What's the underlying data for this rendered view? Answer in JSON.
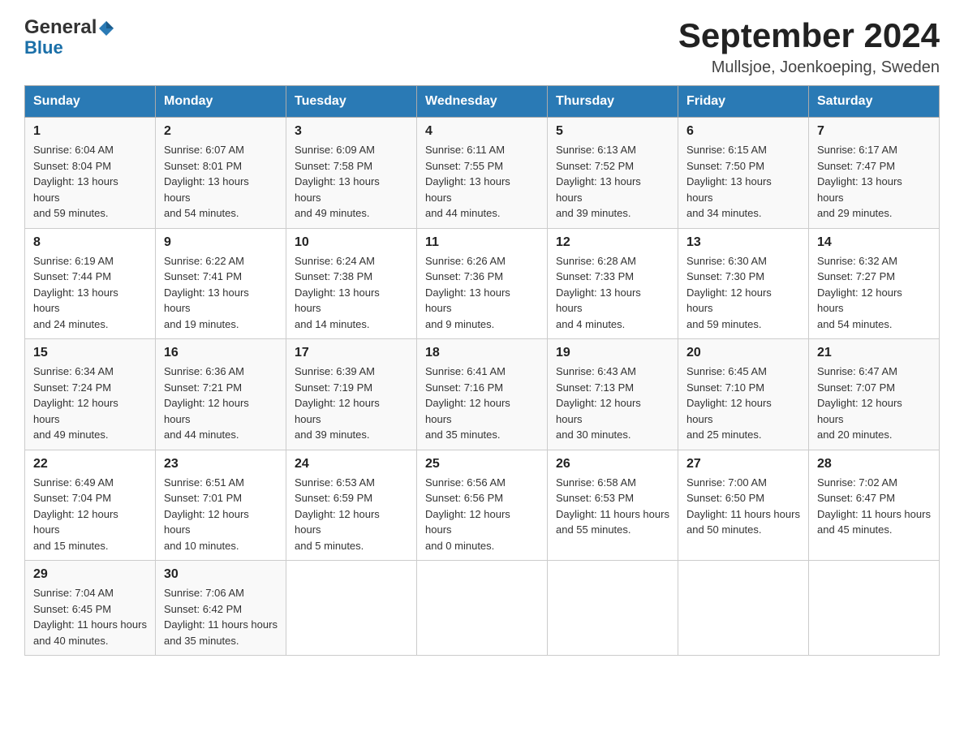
{
  "header": {
    "title": "September 2024",
    "subtitle": "Mullsjoe, Joenkoeping, Sweden",
    "logo": {
      "general": "General",
      "blue": "Blue"
    }
  },
  "weekdays": [
    "Sunday",
    "Monday",
    "Tuesday",
    "Wednesday",
    "Thursday",
    "Friday",
    "Saturday"
  ],
  "weeks": [
    [
      {
        "day": "1",
        "sunrise": "6:04 AM",
        "sunset": "8:04 PM",
        "daylight": "13 hours and 59 minutes."
      },
      {
        "day": "2",
        "sunrise": "6:07 AM",
        "sunset": "8:01 PM",
        "daylight": "13 hours and 54 minutes."
      },
      {
        "day": "3",
        "sunrise": "6:09 AM",
        "sunset": "7:58 PM",
        "daylight": "13 hours and 49 minutes."
      },
      {
        "day": "4",
        "sunrise": "6:11 AM",
        "sunset": "7:55 PM",
        "daylight": "13 hours and 44 minutes."
      },
      {
        "day": "5",
        "sunrise": "6:13 AM",
        "sunset": "7:52 PM",
        "daylight": "13 hours and 39 minutes."
      },
      {
        "day": "6",
        "sunrise": "6:15 AM",
        "sunset": "7:50 PM",
        "daylight": "13 hours and 34 minutes."
      },
      {
        "day": "7",
        "sunrise": "6:17 AM",
        "sunset": "7:47 PM",
        "daylight": "13 hours and 29 minutes."
      }
    ],
    [
      {
        "day": "8",
        "sunrise": "6:19 AM",
        "sunset": "7:44 PM",
        "daylight": "13 hours and 24 minutes."
      },
      {
        "day": "9",
        "sunrise": "6:22 AM",
        "sunset": "7:41 PM",
        "daylight": "13 hours and 19 minutes."
      },
      {
        "day": "10",
        "sunrise": "6:24 AM",
        "sunset": "7:38 PM",
        "daylight": "13 hours and 14 minutes."
      },
      {
        "day": "11",
        "sunrise": "6:26 AM",
        "sunset": "7:36 PM",
        "daylight": "13 hours and 9 minutes."
      },
      {
        "day": "12",
        "sunrise": "6:28 AM",
        "sunset": "7:33 PM",
        "daylight": "13 hours and 4 minutes."
      },
      {
        "day": "13",
        "sunrise": "6:30 AM",
        "sunset": "7:30 PM",
        "daylight": "12 hours and 59 minutes."
      },
      {
        "day": "14",
        "sunrise": "6:32 AM",
        "sunset": "7:27 PM",
        "daylight": "12 hours and 54 minutes."
      }
    ],
    [
      {
        "day": "15",
        "sunrise": "6:34 AM",
        "sunset": "7:24 PM",
        "daylight": "12 hours and 49 minutes."
      },
      {
        "day": "16",
        "sunrise": "6:36 AM",
        "sunset": "7:21 PM",
        "daylight": "12 hours and 44 minutes."
      },
      {
        "day": "17",
        "sunrise": "6:39 AM",
        "sunset": "7:19 PM",
        "daylight": "12 hours and 39 minutes."
      },
      {
        "day": "18",
        "sunrise": "6:41 AM",
        "sunset": "7:16 PM",
        "daylight": "12 hours and 35 minutes."
      },
      {
        "day": "19",
        "sunrise": "6:43 AM",
        "sunset": "7:13 PM",
        "daylight": "12 hours and 30 minutes."
      },
      {
        "day": "20",
        "sunrise": "6:45 AM",
        "sunset": "7:10 PM",
        "daylight": "12 hours and 25 minutes."
      },
      {
        "day": "21",
        "sunrise": "6:47 AM",
        "sunset": "7:07 PM",
        "daylight": "12 hours and 20 minutes."
      }
    ],
    [
      {
        "day": "22",
        "sunrise": "6:49 AM",
        "sunset": "7:04 PM",
        "daylight": "12 hours and 15 minutes."
      },
      {
        "day": "23",
        "sunrise": "6:51 AM",
        "sunset": "7:01 PM",
        "daylight": "12 hours and 10 minutes."
      },
      {
        "day": "24",
        "sunrise": "6:53 AM",
        "sunset": "6:59 PM",
        "daylight": "12 hours and 5 minutes."
      },
      {
        "day": "25",
        "sunrise": "6:56 AM",
        "sunset": "6:56 PM",
        "daylight": "12 hours and 0 minutes."
      },
      {
        "day": "26",
        "sunrise": "6:58 AM",
        "sunset": "6:53 PM",
        "daylight": "11 hours and 55 minutes."
      },
      {
        "day": "27",
        "sunrise": "7:00 AM",
        "sunset": "6:50 PM",
        "daylight": "11 hours and 50 minutes."
      },
      {
        "day": "28",
        "sunrise": "7:02 AM",
        "sunset": "6:47 PM",
        "daylight": "11 hours and 45 minutes."
      }
    ],
    [
      {
        "day": "29",
        "sunrise": "7:04 AM",
        "sunset": "6:45 PM",
        "daylight": "11 hours and 40 minutes."
      },
      {
        "day": "30",
        "sunrise": "7:06 AM",
        "sunset": "6:42 PM",
        "daylight": "11 hours and 35 minutes."
      },
      null,
      null,
      null,
      null,
      null
    ]
  ],
  "labels": {
    "sunrise": "Sunrise:",
    "sunset": "Sunset:",
    "daylight": "Daylight:"
  }
}
